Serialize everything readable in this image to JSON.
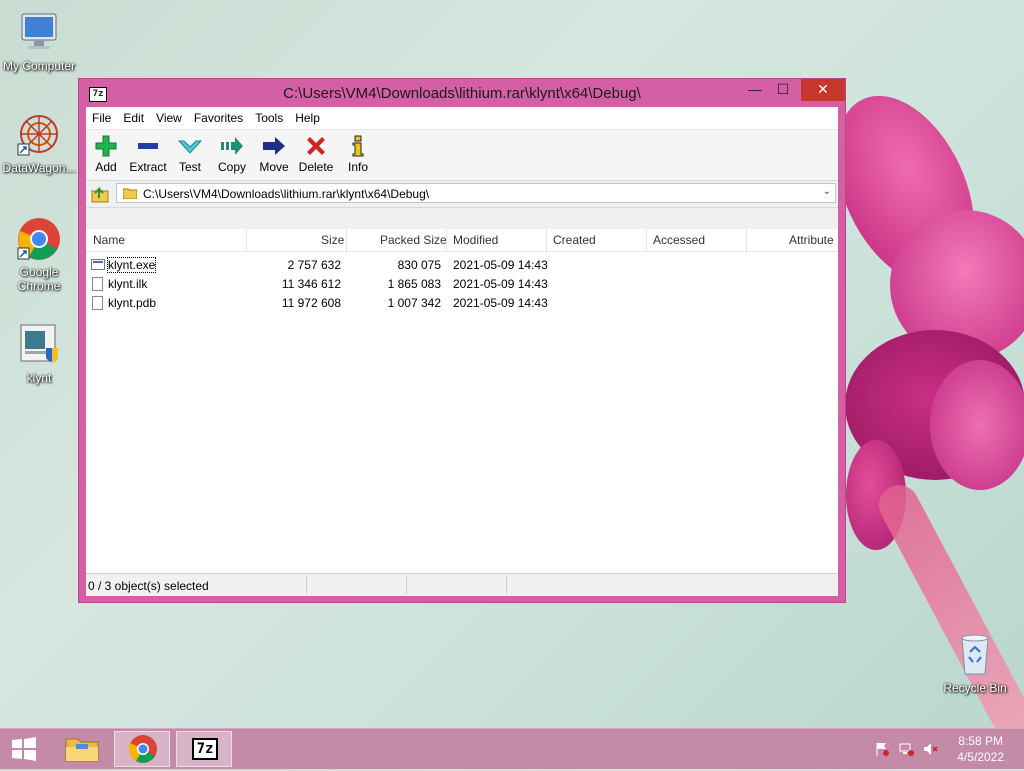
{
  "desktop": {
    "icons": [
      {
        "label": "My Computer",
        "icon": "computer-icon"
      },
      {
        "label": "DataWagon...",
        "icon": "datawagon-icon"
      },
      {
        "label": "Google Chrome",
        "icon": "chrome-icon"
      },
      {
        "label": "klynt",
        "icon": "klynt-installer-icon"
      },
      {
        "label": "Recycle Bin",
        "icon": "recycle-bin-icon"
      }
    ]
  },
  "window": {
    "title": "C:\\Users\\VM4\\Downloads\\lithium.rar\\klynt\\x64\\Debug\\",
    "app_icon_text": "7z",
    "min_glyph": "—",
    "max_glyph": "☐",
    "close_glyph": "✕"
  },
  "menu": [
    "File",
    "Edit",
    "View",
    "Favorites",
    "Tools",
    "Help"
  ],
  "toolbar": {
    "add": "Add",
    "extract": "Extract",
    "test": "Test",
    "copy": "Copy",
    "move": "Move",
    "delete": "Delete",
    "info": "Info"
  },
  "address": {
    "path": "C:\\Users\\VM4\\Downloads\\lithium.rar\\klynt\\x64\\Debug\\",
    "dropdown_glyph": "⌄"
  },
  "columns": {
    "name": "Name",
    "size": "Size",
    "packed": "Packed Size",
    "modified": "Modified",
    "created": "Created",
    "accessed": "Accessed",
    "attributes": "Attribute"
  },
  "files": [
    {
      "name": "klynt.exe",
      "size": "2 757 632",
      "packed": "830 075",
      "modified": "2021-05-09 14:43"
    },
    {
      "name": "klynt.ilk",
      "size": "11 346 612",
      "packed": "1 865 083",
      "modified": "2021-05-09 14:43"
    },
    {
      "name": "klynt.pdb",
      "size": "11 972 608",
      "packed": "1 007 342",
      "modified": "2021-05-09 14:43"
    }
  ],
  "status": {
    "selected": "0 / 3 object(s) selected"
  },
  "scroll": {
    "left": "<",
    "right": ">"
  },
  "taskbar": {
    "time": "8:58 PM",
    "date": "4/5/2022",
    "sevenzip_text": "7z"
  }
}
